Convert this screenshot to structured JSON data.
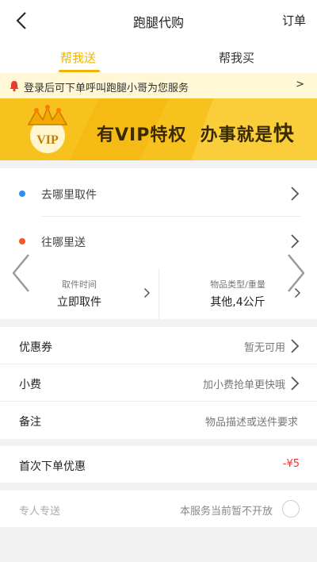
{
  "header": {
    "title": "跑腿代购",
    "orders_label": "订单"
  },
  "tabs": [
    {
      "label": "帮我送",
      "active": true
    },
    {
      "label": "帮我买",
      "active": false
    }
  ],
  "notice": {
    "text": "登录后可下单呼叫跑腿小哥为您服务",
    "arrow": ">"
  },
  "vip_banner": {
    "badge_text": "VIP",
    "slogan_part1": "有VIP特权",
    "slogan_part2": "办事就是",
    "slogan_emph": "快"
  },
  "address": {
    "pickup_label": "去哪里取件",
    "deliver_label": "往哪里送",
    "pickup_dot_color": "#2f8ef0",
    "deliver_dot_color": "#f05a28"
  },
  "info": {
    "pickup_time_caption": "取件时间",
    "pickup_time_value": "立即取件",
    "item_caption": "物品类型/重量",
    "item_value": "其他,4公斤"
  },
  "options": [
    {
      "key": "优惠券",
      "value": "暂无可用",
      "chevron": true
    },
    {
      "key": "小费",
      "value": "加小费抢单更快哦",
      "chevron": true
    },
    {
      "key": "备注",
      "value": "物品描述或送件要求",
      "chevron": false
    }
  ],
  "first_order": {
    "label": "首次下单优惠",
    "value": "-¥5"
  },
  "special": {
    "label": "专人专送",
    "value": "本服务当前暂不开放"
  },
  "colors": {
    "accent": "#f0b400",
    "vip_yellow": "#f7c11e",
    "discount_red": "#e33"
  }
}
